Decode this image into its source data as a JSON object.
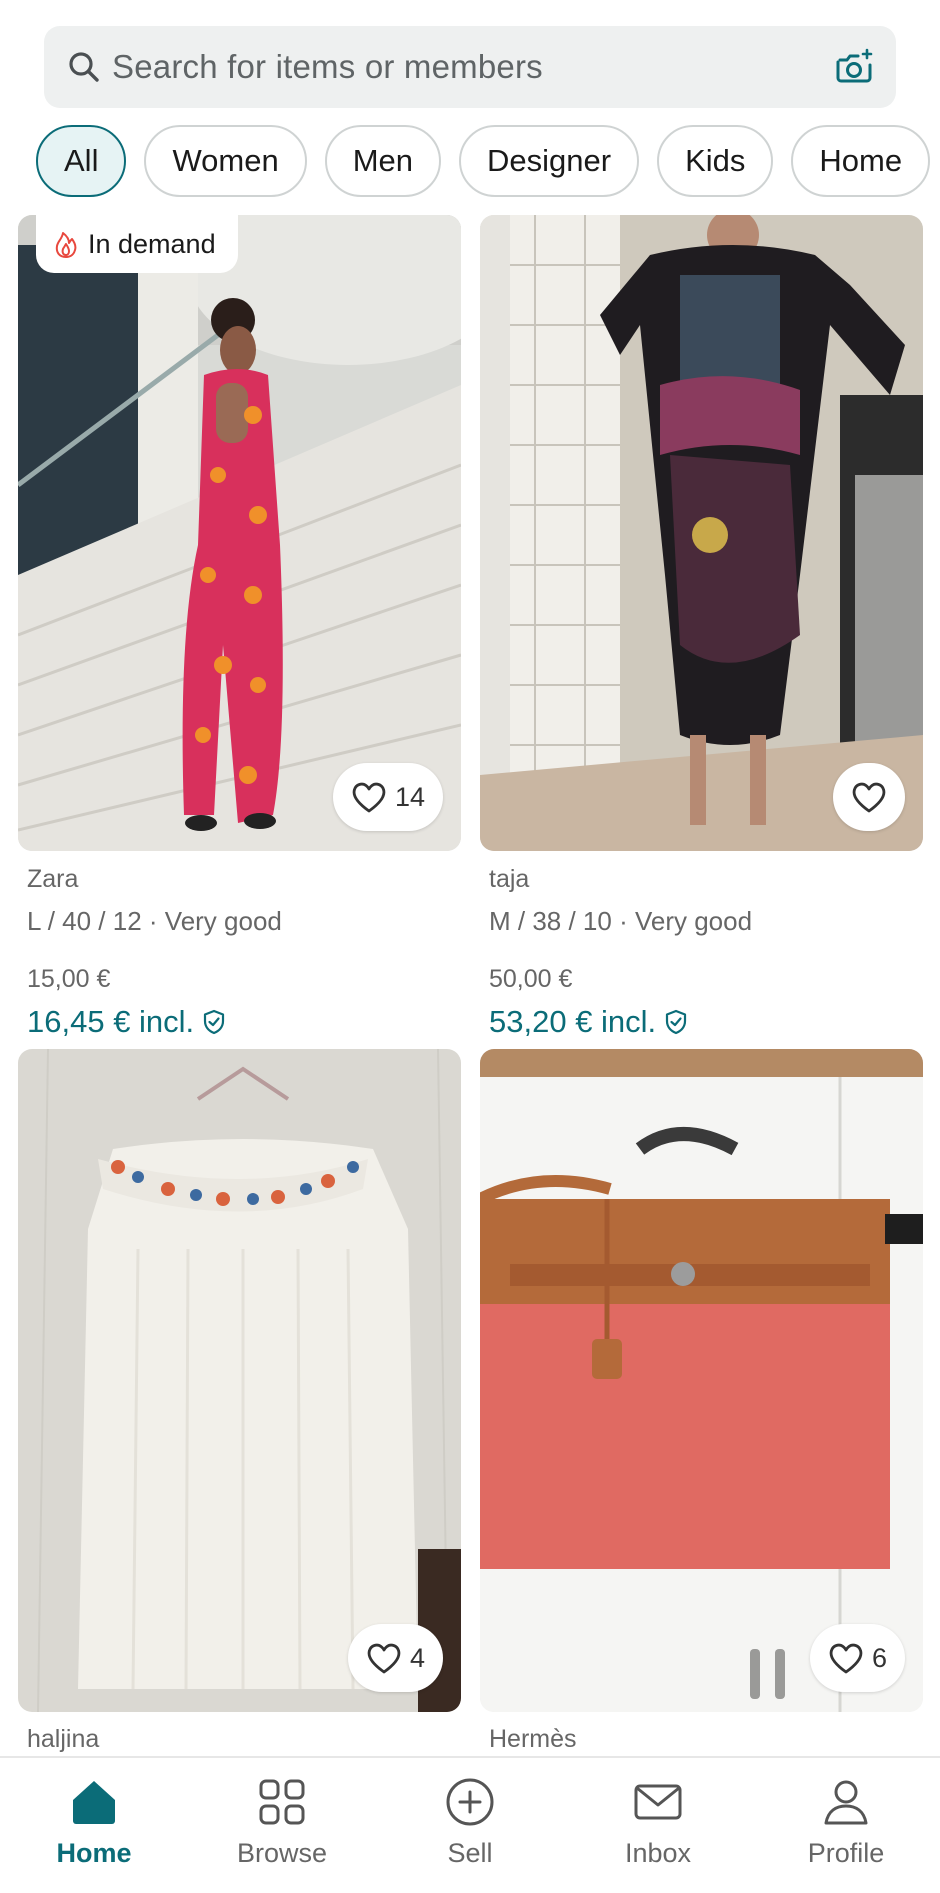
{
  "search": {
    "placeholder": "Search for items or members",
    "icon": "search-icon",
    "camera_icon": "camera-plus-icon"
  },
  "chips": [
    {
      "label": "All",
      "active": true
    },
    {
      "label": "Women",
      "active": false
    },
    {
      "label": "Men",
      "active": false
    },
    {
      "label": "Designer",
      "active": false
    },
    {
      "label": "Kids",
      "active": false
    },
    {
      "label": "Home",
      "active": false
    }
  ],
  "items": [
    {
      "badge": "In demand",
      "favorites": "14",
      "brand": "Zara",
      "size": "L / 40 / 12 · Very good",
      "price": "15,00 €",
      "price_incl": "16,45 € incl."
    },
    {
      "badge": "",
      "favorites": "",
      "brand": "taja",
      "size": "M / 38 / 10 · Very good",
      "price": "50,00 €",
      "price_incl": "53,20 € incl."
    },
    {
      "badge": "",
      "favorites": "4",
      "brand": "haljina",
      "size": "",
      "price": "",
      "price_incl": ""
    },
    {
      "badge": "",
      "favorites": "6",
      "brand": "Hermès",
      "size": "",
      "price": "",
      "price_incl": ""
    }
  ],
  "nav": [
    {
      "label": "Home",
      "icon": "home-icon",
      "active": true
    },
    {
      "label": "Browse",
      "icon": "grid-icon",
      "active": false
    },
    {
      "label": "Sell",
      "icon": "plus-circle-icon",
      "active": false
    },
    {
      "label": "Inbox",
      "icon": "envelope-icon",
      "active": false
    },
    {
      "label": "Profile",
      "icon": "person-icon",
      "active": false
    }
  ],
  "colors": {
    "accent": "#0b6c78",
    "chip_active_bg": "#e6f3f4",
    "search_bg": "#eef0f0",
    "badge_flame": "#e8483e"
  }
}
